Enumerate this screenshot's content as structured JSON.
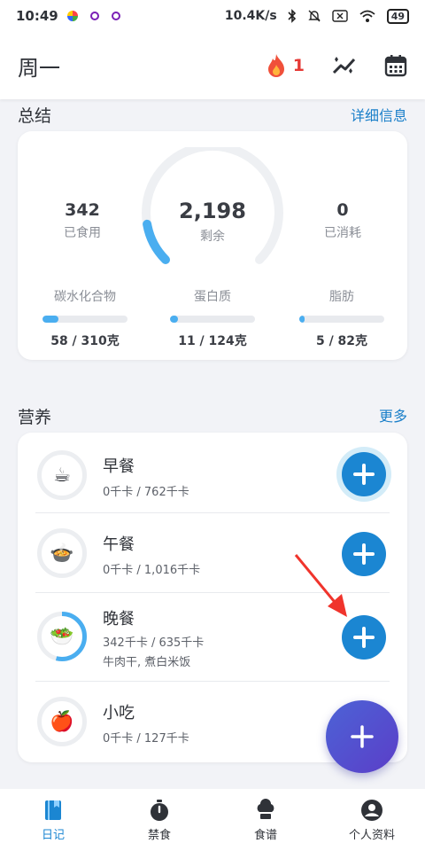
{
  "status_bar": {
    "time": "10:49",
    "net_speed": "10.4K/s",
    "battery": "49"
  },
  "header": {
    "day": "周一",
    "streak_count": "1"
  },
  "summary": {
    "title": "总结",
    "details_link": "详细信息",
    "eaten": {
      "value": "342",
      "label": "已食用"
    },
    "remaining": {
      "value": "2,198",
      "label": "剩余"
    },
    "burned": {
      "value": "0",
      "label": "已消耗"
    },
    "remaining_fraction": 0.13,
    "macros": [
      {
        "name": "碳水化合物",
        "value": "58 / 310克",
        "fraction": 0.19
      },
      {
        "name": "蛋白质",
        "value": "11 / 124克",
        "fraction": 0.09
      },
      {
        "name": "脂肪",
        "value": "5 / 82克",
        "fraction": 0.06
      }
    ]
  },
  "nutrition": {
    "title": "营养",
    "more_link": "更多",
    "meals": [
      {
        "name": "早餐",
        "kcal": "0千卡 / 762千卡",
        "icon": "coffee-cup-icon",
        "fraction": 0
      },
      {
        "name": "午餐",
        "kcal": "0千卡 / 1,016千卡",
        "icon": "pot-icon",
        "fraction": 0
      },
      {
        "name": "晚餐",
        "kcal": "342千卡 / 635千卡",
        "extra": "牛肉干, 煮白米饭",
        "icon": "salad-icon",
        "fraction": 0.54
      },
      {
        "name": "小吃",
        "kcal": "0千卡 / 127千卡",
        "icon": "apple-icon",
        "fraction": 0
      }
    ]
  },
  "nav": {
    "diary": "日记",
    "fasting": "禁食",
    "recipes": "食谱",
    "profile": "个人资料"
  },
  "colors": {
    "accent": "#1b86d2",
    "fab": "#4c63d6",
    "streak": "#e53935"
  }
}
